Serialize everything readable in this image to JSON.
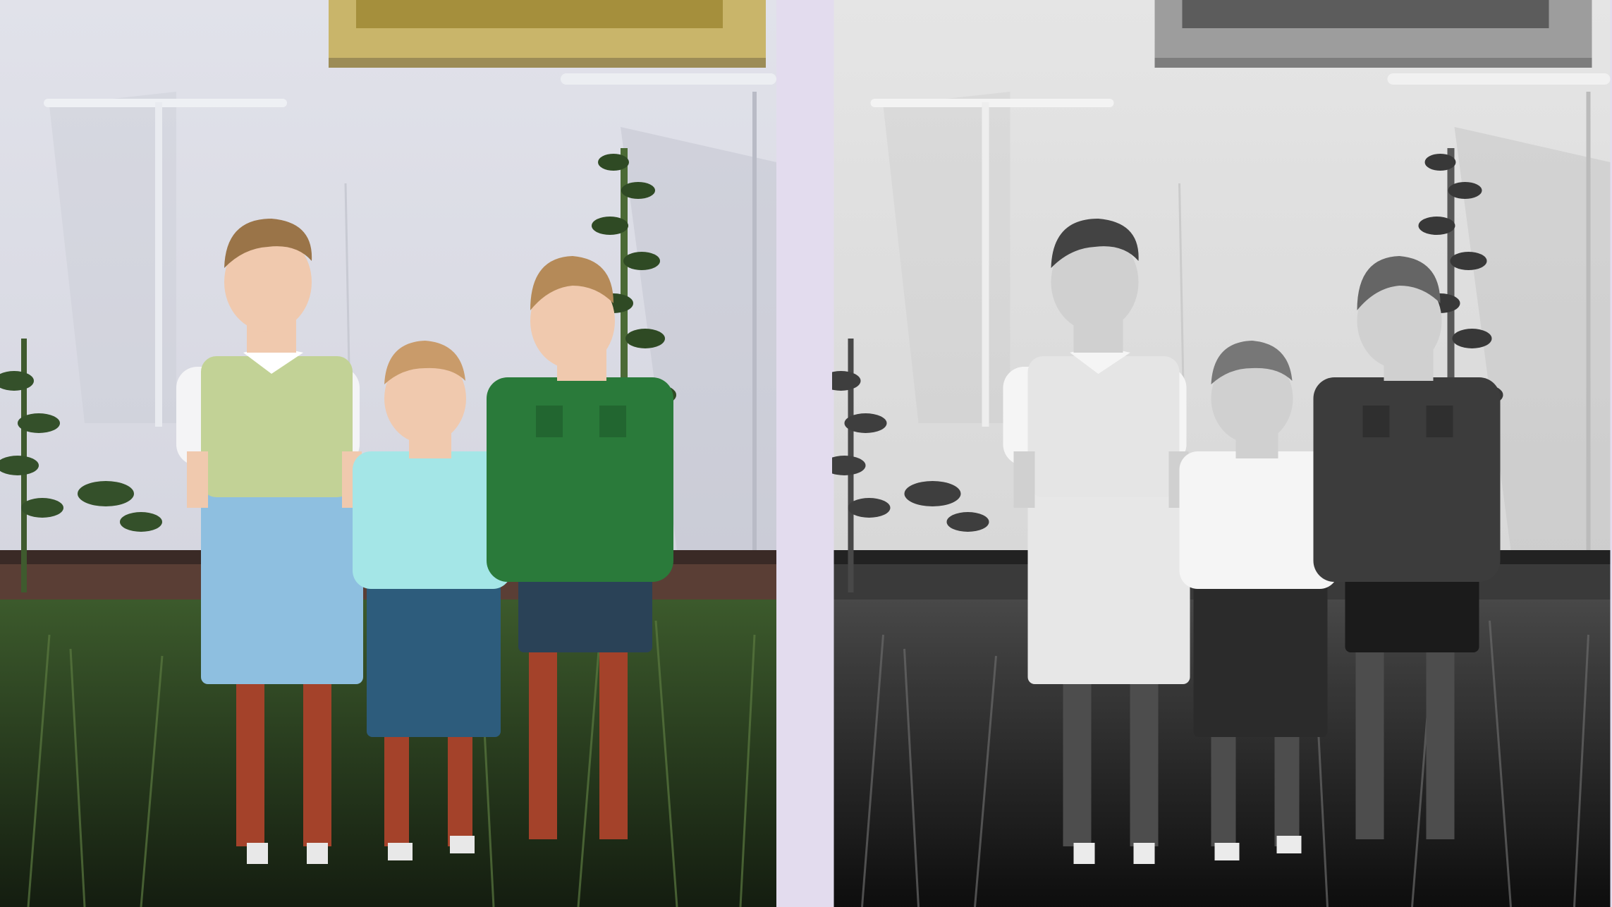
{
  "scene": {
    "description_free": true,
    "panels": [
      {
        "id": "colorized",
        "mode": "color"
      },
      {
        "id": "original",
        "mode": "grayscale"
      }
    ],
    "colors": {
      "background": "#e3dcee",
      "wall": "#dcdde6",
      "window_frame": "#c9b56a",
      "grass_dark": "#1f2b17",
      "grass_mid": "#3c5a2c",
      "boy1_vest": "#c2d296",
      "boy1_shorts": "#8ebfe0",
      "boy2_shirt": "#a4e6e7",
      "boy2_shorts": "#2d5c7c",
      "boy3_shirt": "#2a7a3a",
      "boy3_shorts": "#2a4257",
      "skin": "#f0c9ae",
      "legs": "#a4422a",
      "hair": "#9a7448"
    }
  }
}
